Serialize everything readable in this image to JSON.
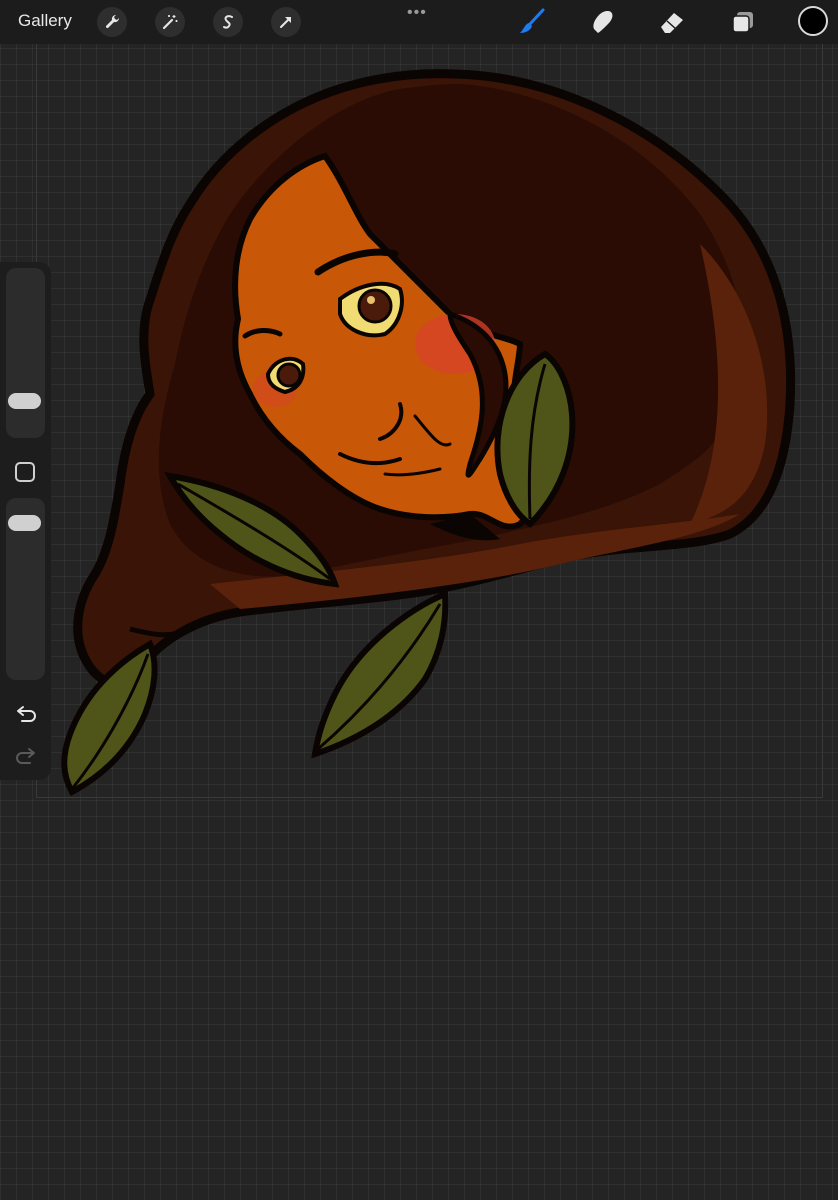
{
  "toolbar": {
    "gallery_label": "Gallery",
    "left_tools": [
      "wrench-icon",
      "magic-wand-icon",
      "selection-s-icon",
      "transform-arrow-icon"
    ],
    "more_label": "•••",
    "right_tools": [
      "brush-icon",
      "smudge-icon",
      "eraser-icon",
      "layers-icon"
    ],
    "active_tool": "brush",
    "active_color": "#000000",
    "accent": "#1e7cf2"
  },
  "sidebar": {
    "brush_size_level": 0.57,
    "opacity_level": 0.83,
    "undo_icon": "undo-arrow-icon",
    "redo_icon": "redo-arrow-icon"
  },
  "artwork": {
    "palette": {
      "hair": "#3a1406",
      "hair_shadow": "#240903",
      "skin": "#c95708",
      "blush": "#d8412a",
      "leaf": "#4f5518",
      "outline": "#0a0502"
    }
  }
}
